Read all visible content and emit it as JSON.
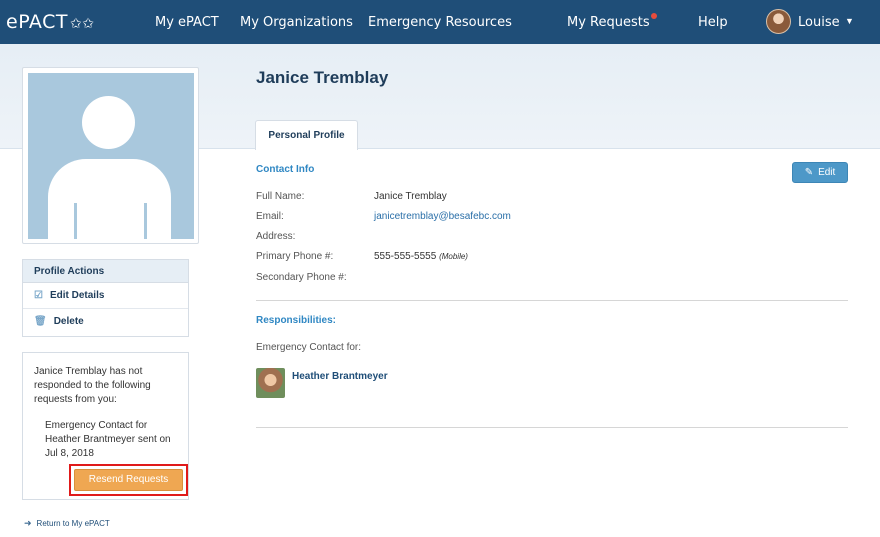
{
  "nav": {
    "logo": "ePACT",
    "items": [
      "My ePACT",
      "My Organizations",
      "Emergency Resources",
      "My Requests",
      "Help"
    ],
    "user_name": "Louise"
  },
  "profile": {
    "name": "Janice Tremblay",
    "tab": "Personal Profile"
  },
  "contact_info": {
    "title": "Contact Info",
    "edit_label": "Edit",
    "fields": [
      {
        "label": "Full Name:",
        "value": "Janice Tremblay"
      },
      {
        "label": "Email:",
        "value": "janicetremblay@besafebc.com"
      },
      {
        "label": "Address:",
        "value": ""
      },
      {
        "label": "Primary Phone #:",
        "value": "555-555-5555",
        "note": "(Mobile)"
      },
      {
        "label": "Secondary Phone #:",
        "value": ""
      }
    ]
  },
  "responsibilities": {
    "title": "Responsibilities:",
    "subtitle": "Emergency Contact for:",
    "contact_name": "Heather Brantmeyer"
  },
  "actions": {
    "title": "Profile Actions",
    "items": [
      "Edit Details",
      "Delete"
    ]
  },
  "pending": {
    "message": "Janice Tremblay has not responded to the following requests from you:",
    "item": "Emergency Contact for Heather Brantmeyer sent on Jul 8, 2018",
    "resend_label": "Resend Requests"
  },
  "return_link": "Return to My ePACT",
  "colors": {
    "nav_bg": "#1f4e78",
    "accent": "#2f87c3",
    "resend": "#efa752",
    "highlight": "#e01a1a"
  }
}
